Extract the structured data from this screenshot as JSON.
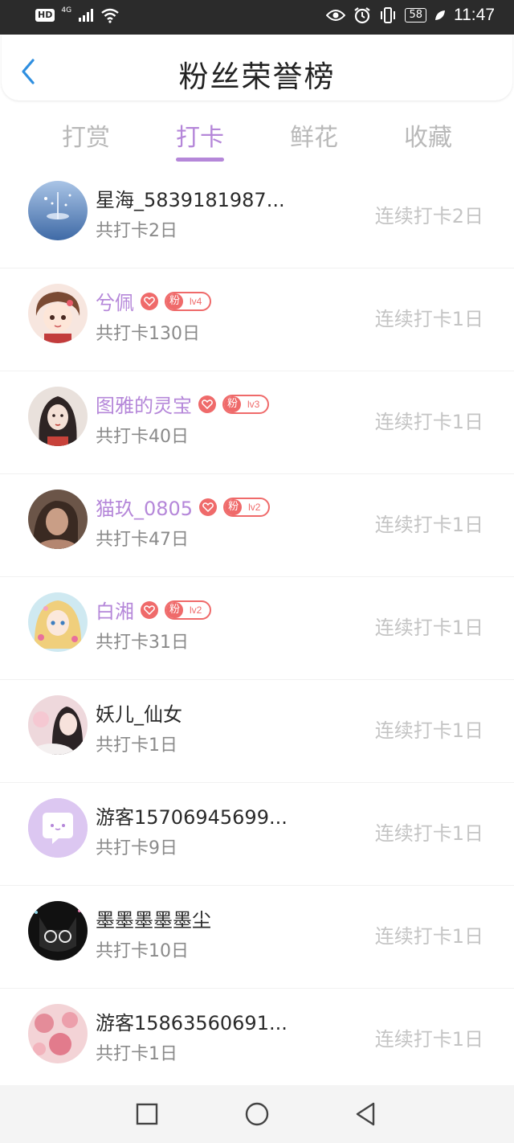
{
  "status_bar": {
    "hd": "HD",
    "network": "4G",
    "battery": "58",
    "time": "11:47"
  },
  "header": {
    "title": "粉丝荣誉榜"
  },
  "tabs": [
    {
      "label": "打赏",
      "active": false
    },
    {
      "label": "打卡",
      "active": true
    },
    {
      "label": "鲜花",
      "active": false
    },
    {
      "label": "收藏",
      "active": false
    }
  ],
  "rows": [
    {
      "name": "星海_5839181987...",
      "vip": false,
      "total": "共打卡2日",
      "streak": "连续打卡2日",
      "level": ""
    },
    {
      "name": "兮佩",
      "vip": true,
      "fan": "粉",
      "level": "lv4",
      "total": "共打卡130日",
      "streak": "连续打卡1日"
    },
    {
      "name": "图雅的灵宝",
      "vip": true,
      "fan": "粉",
      "level": "lv3",
      "total": "共打卡40日",
      "streak": "连续打卡1日"
    },
    {
      "name": "猫玖_0805",
      "vip": true,
      "fan": "粉",
      "level": "lv2",
      "total": "共打卡47日",
      "streak": "连续打卡1日"
    },
    {
      "name": "白湘",
      "vip": true,
      "fan": "粉",
      "level": "lv2",
      "total": "共打卡31日",
      "streak": "连续打卡1日"
    },
    {
      "name": "妖儿_仙女",
      "vip": false,
      "total": "共打卡1日",
      "streak": "连续打卡1日",
      "level": ""
    },
    {
      "name": "游客15706945699...",
      "vip": false,
      "total": "共打卡9日",
      "streak": "连续打卡1日",
      "level": ""
    },
    {
      "name": "墨墨墨墨墨尘",
      "vip": false,
      "total": "共打卡10日",
      "streak": "连续打卡1日",
      "level": ""
    },
    {
      "name": "游客15863560691...",
      "vip": false,
      "total": "共打卡1日",
      "streak": "连续打卡1日",
      "level": ""
    }
  ],
  "icons": {
    "back": "chevron-left-icon",
    "heart": "heart-icon",
    "nav_recent": "square-icon",
    "nav_home": "circle-icon",
    "nav_back": "triangle-back-icon"
  },
  "colors": {
    "accent": "#b587d9",
    "badge": "#ef6a6a",
    "back": "#2f8fe0"
  }
}
